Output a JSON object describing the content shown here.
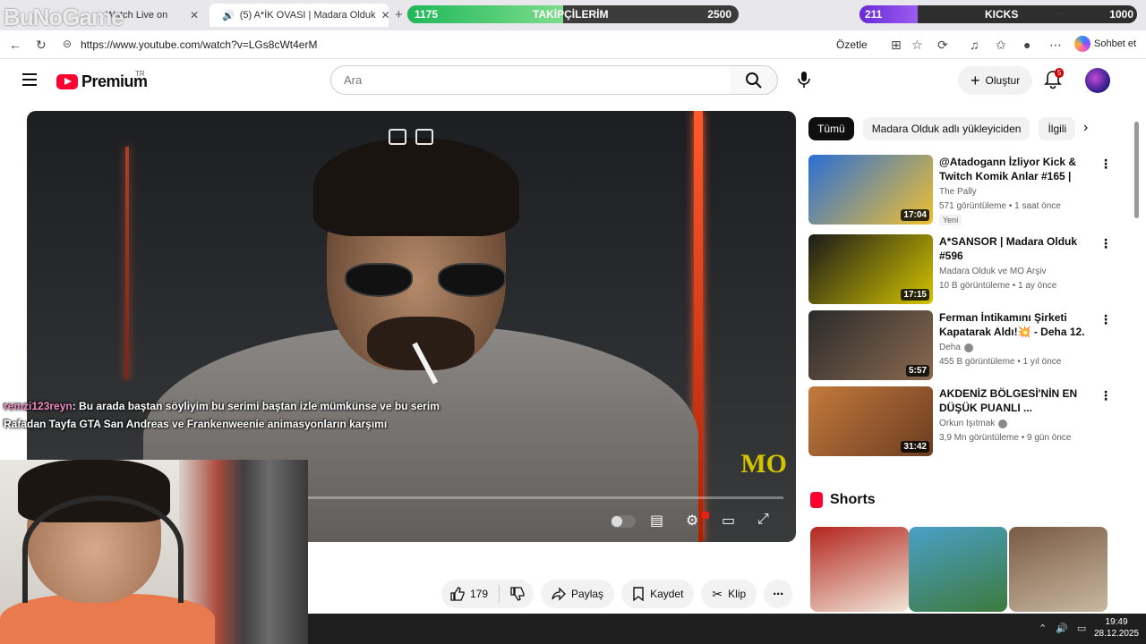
{
  "browser": {
    "overlay_logo": "BuNoGame",
    "tabs": [
      {
        "label": "Watch Live on",
        "active": false
      },
      {
        "label": "(5) A*İK OVASI | Madara Olduk",
        "active": true
      }
    ],
    "follow_bar": {
      "start": "1175",
      "label": "TAKİPÇİLERİM",
      "goal": "2500",
      "fraction": 0.47
    },
    "kick_bar": {
      "start": "211",
      "label": "KICKS",
      "goal": "1000",
      "fraction": 0.21
    },
    "url": "https://www.youtube.com/watch?v=LGs8cWt4erM",
    "summarize_label": "Özetle",
    "chat_label": "Sohbet et"
  },
  "header": {
    "logo_text": "Premium",
    "country_code": "TR",
    "search_placeholder": "Ara",
    "create_label": "Oluştur",
    "notification_count": "5"
  },
  "player": {
    "watermark": "MO",
    "progress_fraction": 0.0
  },
  "chat_overlay": {
    "username": "remzi123reyn",
    "message": ": Bu arada baştan söyliyim bu serimi baştan izle mümkünse ve bu serim Rafadan Tayfa GTA San Andreas ve Frankenweenie animasyonların karşımı"
  },
  "actions": {
    "like_count": "179",
    "share_label": "Paylaş",
    "save_label": "Kaydet",
    "clip_label": "Klip"
  },
  "sidebar": {
    "chips": [
      "Tümü",
      "Madara Olduk adlı yükleyiciden",
      "İlgili"
    ],
    "recommendations": [
      {
        "title": "@Atadogann İzliyor Kick & Twitch Komik Anlar #165 | The...",
        "channel": "The Pally",
        "meta": "571 görüntüleme • 1 saat önce",
        "badge": "Yeni",
        "duration": "17:04",
        "verified": false,
        "thumb_colors": [
          "#2a6fd6",
          "#f0c030"
        ]
      },
      {
        "title": "A*SANSOR | Madara Olduk #596",
        "channel": "Madara Olduk ve MO Arşiv",
        "meta": "10 B görüntüleme • 1 ay önce",
        "badge": "",
        "duration": "17:15",
        "verified": false,
        "thumb_colors": [
          "#1a1a1a",
          "#d4c400"
        ]
      },
      {
        "title": "Ferman İntikamını Şirketi Kapatarak Aldı!💥 - Deha 12. ...",
        "channel": "Deha",
        "meta": "455 B görüntüleme • 1 yıl önce",
        "badge": "",
        "duration": "5:57",
        "verified": true,
        "thumb_colors": [
          "#2b2b2b",
          "#8a6a50"
        ]
      },
      {
        "title": "AKDENİZ BÖLGESİ'NİN EN DÜŞÜK PUANLI ...",
        "channel": "Orkun Işıtmak",
        "meta": "3,9 Mn görüntüleme • 9 gün önce",
        "badge": "",
        "duration": "31:42",
        "verified": true,
        "thumb_colors": [
          "#c47a3c",
          "#6b3d22"
        ]
      }
    ],
    "shorts_title": "Shorts",
    "shorts": [
      {
        "colors": [
          "#b3261e",
          "#f1e6d8"
        ]
      },
      {
        "colors": [
          "#4aa0c8",
          "#3d7a3d"
        ]
      },
      {
        "colors": [
          "#7a5a44",
          "#c8b8a0"
        ]
      }
    ]
  },
  "taskbar": {
    "time": "19:49",
    "date": "28.12.2025"
  }
}
